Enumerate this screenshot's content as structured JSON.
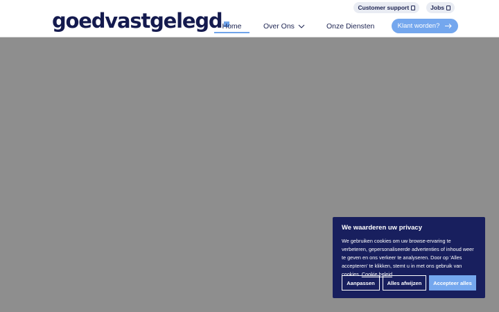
{
  "topbar": {
    "support_label": "Customer support",
    "jobs_label": "Jobs"
  },
  "logo": {
    "text": "goedvastgelegd"
  },
  "nav": {
    "home": "Home",
    "over_ons": "Over Ons",
    "diensten": "Onze Diensten"
  },
  "cta": {
    "label": "Klant worden?"
  },
  "cookie": {
    "title": "We waarderen uw privacy",
    "body": "We gebruiken cookies om uw browse-ervaring te verbeteren, gepersonaliseerde advertenties of inhoud weer te geven en ons verkeer te analyseren. Door op 'Alles accepteren' te klikken, stemt u in met ons gebruik van cookies.",
    "policy_link": "Cookie beleid",
    "customize_label": "Aanpassen",
    "reject_label": "Alles afwijzen",
    "accept_label": "Accepteer alles"
  },
  "colors": {
    "brand_navy": "#141a4e",
    "accent_blue": "#74a7ee",
    "overlay_gray": "#8e8e8e",
    "banner_bg": "#181f5e"
  },
  "icons": {
    "external": "external-link-icon",
    "chevron": "chevron-down-icon",
    "arrow": "arrow-right-icon"
  }
}
